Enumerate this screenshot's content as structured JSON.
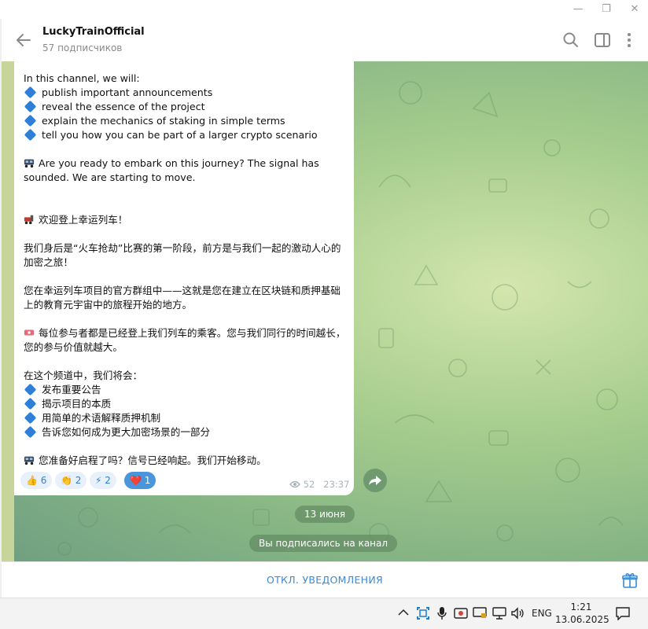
{
  "header": {
    "title": "LuckyTrainOfficial",
    "subtitle": "57 подписчиков"
  },
  "message": {
    "en_intro": "In this channel, we will:",
    "en_items": [
      "publish important announcements",
      "reveal the essence of the project",
      "explain the mechanics of staking in simple terms",
      "tell you how you can be part of a larger crypto scenario"
    ],
    "en_outro": "Are you ready to embark on this journey? The signal has sounded. We are starting to move.",
    "zh_welcome": "欢迎登上幸运列车！",
    "zh_p1": "我们身后是“火车抢劫”比赛的第一阶段，前方是与我们一起的激动人心的加密之旅！",
    "zh_p2": "您在幸运列车项目的官方群组中——这就是您在建立在区块链和质押基础上的教育元宇宙中的旅程开始的地方。",
    "zh_p3": "每位参与者都是已经登上我们列车的乘客。您与我们同行的时间越长，您的参与价值就越大。",
    "zh_intro": "在这个频道中，我们将会：",
    "zh_items": [
      "发布重要公告",
      "揭示项目的本质",
      "用简单的术语解释质押机制",
      "告诉您如何成为更大加密场景的一部分"
    ],
    "zh_outro": "您准备好启程了吗？信号已经响起。我们开始移动。",
    "reactions": [
      {
        "emoji": "👍",
        "count": "6"
      },
      {
        "emoji": "👏",
        "count": "2"
      },
      {
        "emoji": "⚡",
        "count": "2"
      },
      {
        "emoji": "❤️",
        "count": "1"
      }
    ],
    "views": "52",
    "time": "23:37"
  },
  "service": {
    "date": "13 июня",
    "subscribed": "Вы подписались на канал"
  },
  "bottom": {
    "mute_label": "ОТКЛ. УВЕДОМЛЕНИЯ"
  },
  "taskbar": {
    "lang": "ENG",
    "time": "1:21",
    "date": "13.06.2025"
  },
  "colors": {
    "accent": "#3a8ad4",
    "bubble": "#ffffff",
    "reaction_active": "#4a95db"
  }
}
